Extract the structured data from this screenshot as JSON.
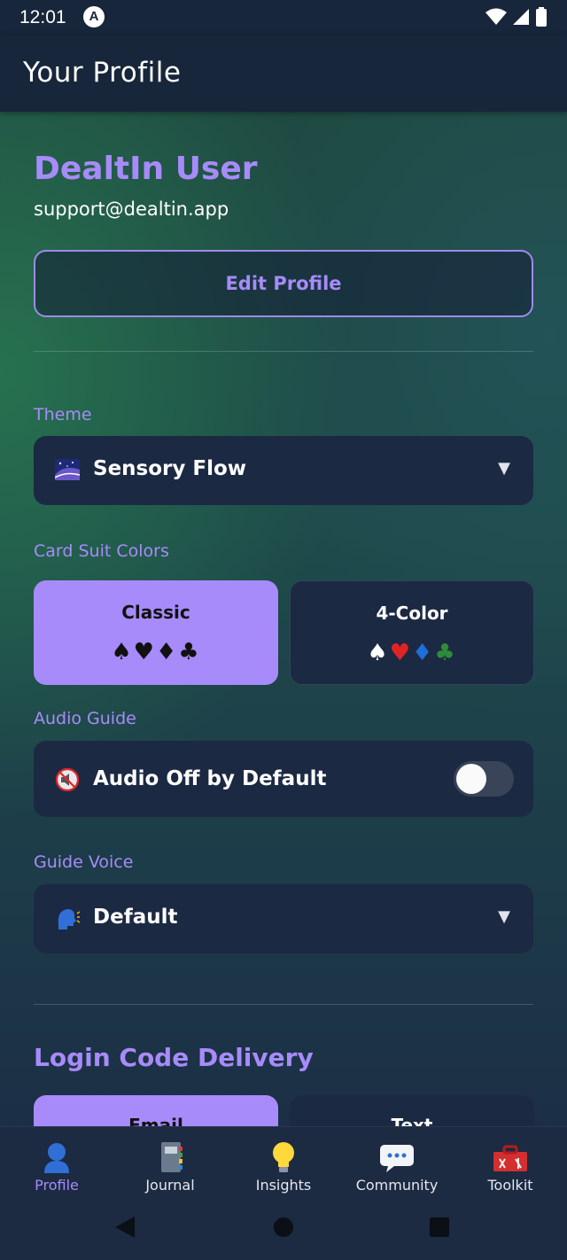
{
  "status_bar": {
    "time": "12:01",
    "app_icon_letter": "A"
  },
  "header": {
    "title": "Your Profile"
  },
  "profile": {
    "name": "DealtIn User",
    "email": "support@dealtin.app",
    "edit_label": "Edit Profile"
  },
  "theme": {
    "label": "Theme",
    "value": "Sensory Flow",
    "icon": "galaxy-icon"
  },
  "card_suits": {
    "label": "Card Suit Colors",
    "options": [
      {
        "title": "Classic",
        "glyphs": "♠♥♦♣",
        "selected": true
      },
      {
        "title": "4-Color",
        "glyphs": "♠♥♦♣",
        "selected": false
      }
    ],
    "four_color_colors": [
      "#ffffff",
      "#e02424",
      "#1e6fd9",
      "#2e8b3a"
    ]
  },
  "audio": {
    "label": "Audio Guide",
    "value": "Audio Off by Default",
    "icon": "muted-speaker-icon",
    "enabled": false
  },
  "voice": {
    "label": "Guide Voice",
    "value": "Default",
    "icon": "speaking-head-icon"
  },
  "login": {
    "title": "Login Code Delivery",
    "options": [
      "Email",
      "Text"
    ]
  },
  "nav": {
    "items": [
      {
        "label": "Profile",
        "icon": "person-icon",
        "active": true
      },
      {
        "label": "Journal",
        "icon": "notebook-icon",
        "active": false
      },
      {
        "label": "Insights",
        "icon": "lightbulb-icon",
        "active": false
      },
      {
        "label": "Community",
        "icon": "chat-bubble-icon",
        "active": false
      },
      {
        "label": "Toolkit",
        "icon": "toolbox-icon",
        "active": false
      }
    ]
  },
  "colors": {
    "accent": "#a78bfa",
    "card": "#1c2942",
    "header": "#17263a"
  }
}
